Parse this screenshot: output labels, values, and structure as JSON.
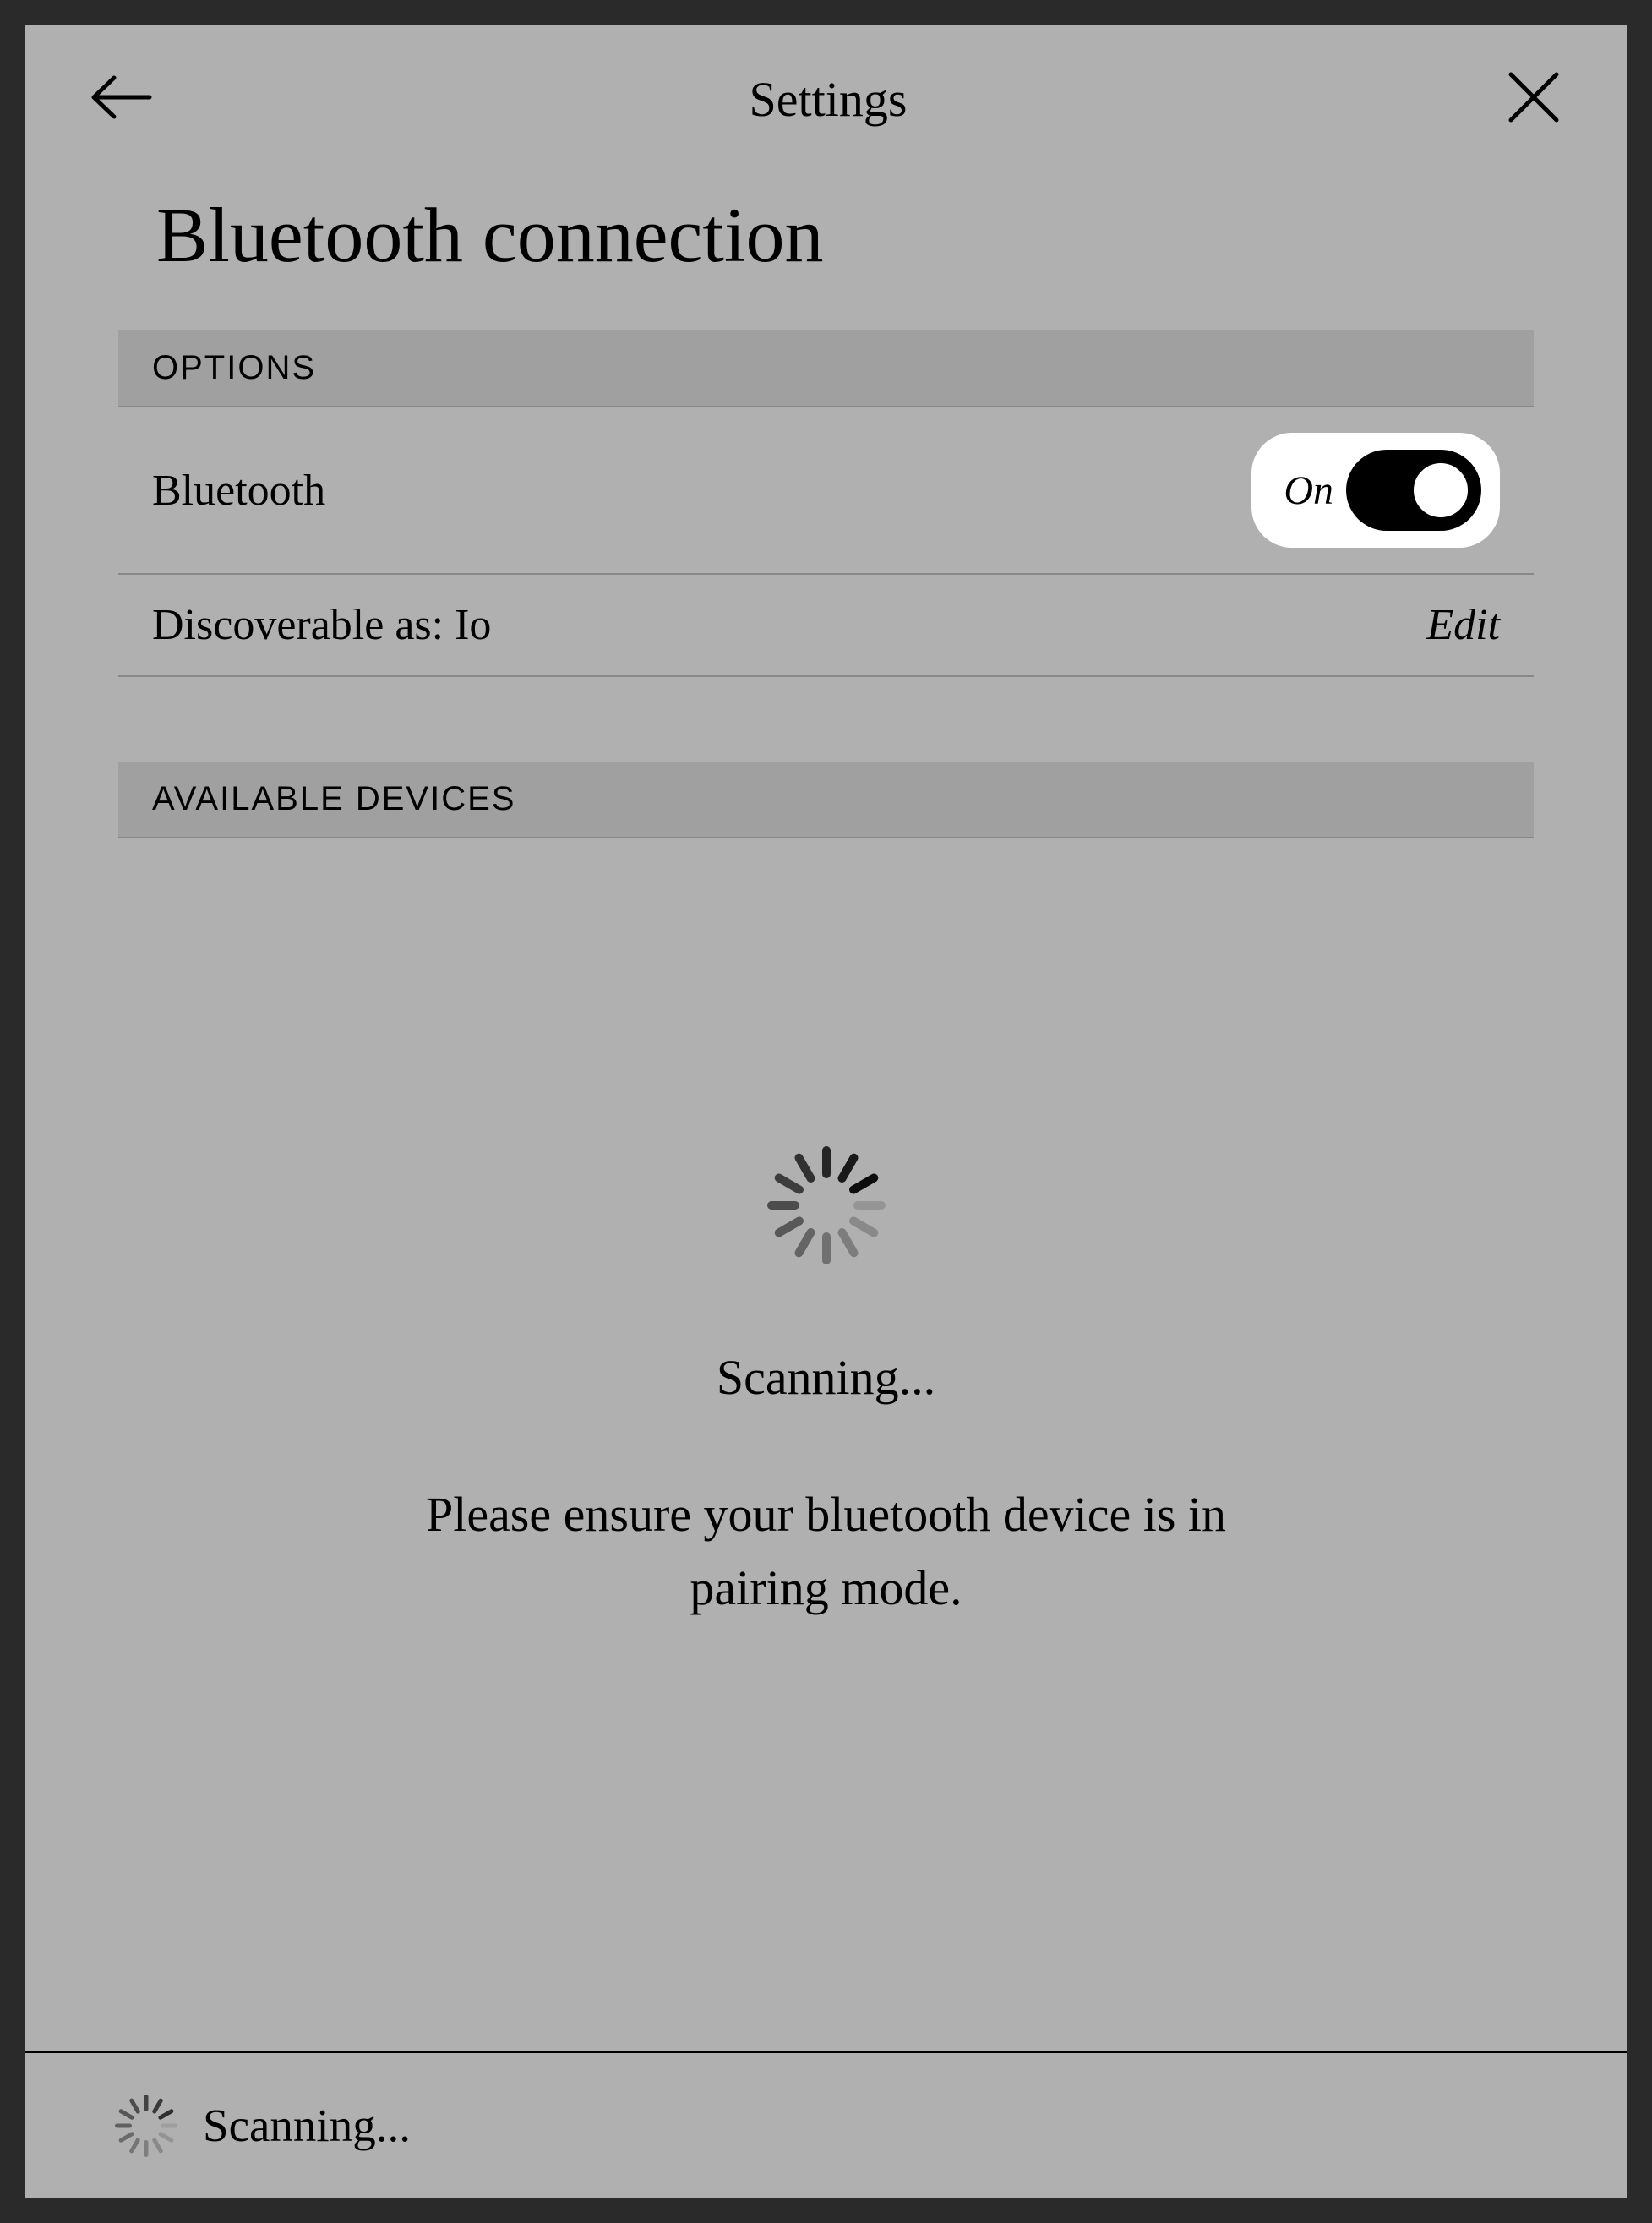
{
  "header": {
    "title": "Settings"
  },
  "page": {
    "title": "Bluetooth connection"
  },
  "sections": {
    "options": {
      "header": "OPTIONS",
      "bluetooth": {
        "label": "Bluetooth",
        "toggle_state": "On"
      },
      "discoverable": {
        "label": "Discoverable as: Io",
        "action": "Edit"
      }
    },
    "devices": {
      "header": "AVAILABLE DEVICES"
    }
  },
  "scanning": {
    "status": "Scanning...",
    "instruction": "Please ensure your bluetooth device is in pairing mode."
  },
  "footer": {
    "status": "Scanning..."
  }
}
